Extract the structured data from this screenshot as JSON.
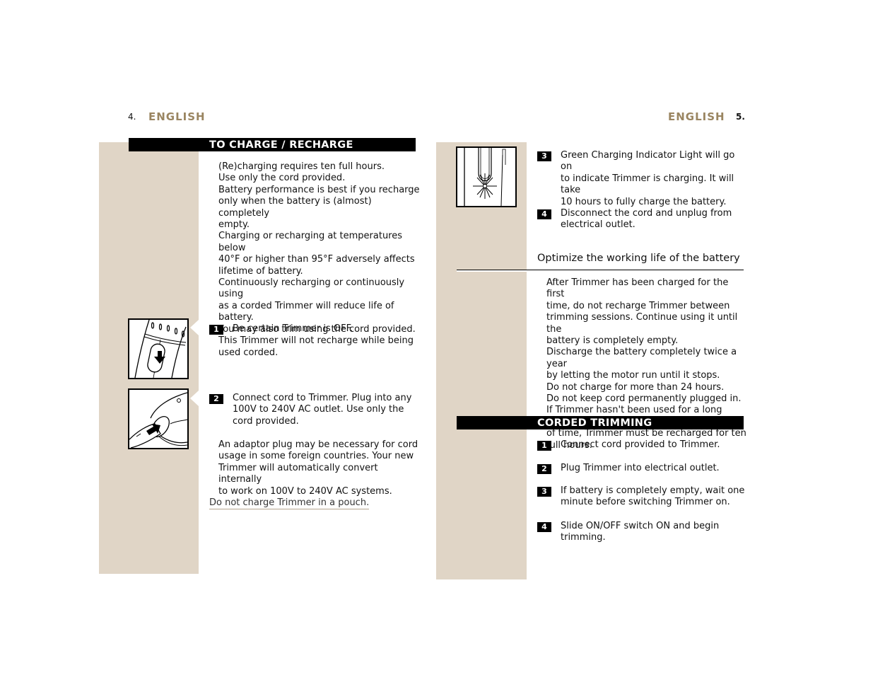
{
  "left_page": {
    "page_number": "4.",
    "language": "ENGLISH",
    "section_title": "TO CHARGE / RECHARGE",
    "intro_lines": [
      "(Re)charging requires ten full hours.",
      "Use only the cord provided.",
      "Battery performance is best if you recharge",
      "only when the battery is (almost) completely",
      "empty.",
      "Charging or recharging at temperatures below",
      "40°F or higher than 95°F adversely affects",
      "lifetime of battery.",
      "Continuously recharging or continuously using",
      "as a corded Trimmer will reduce life of battery.",
      "You may also trim using the cord provided.",
      "This Trimmer will not recharge while being",
      "used corded."
    ],
    "steps": [
      {
        "number": "1",
        "lines": [
          "Be certain Trimmer is OFF."
        ]
      },
      {
        "number": "2",
        "lines": [
          "Connect cord to Trimmer.  Plug into any",
          "100V to 240V AC outlet.  Use only the",
          "cord provided."
        ]
      }
    ],
    "adaptor_note_lines": [
      "An adaptor plug may be necessary for cord",
      "usage in some foreign countries. Your new",
      "Trimmer will automatically convert internally",
      "to work on 100V to 240V AC systems."
    ],
    "warning": "Do not charge Trimmer in a pouch.",
    "figures": [
      "switch-off-illustration",
      "plug-cord-illustration"
    ]
  },
  "right_page": {
    "page_number": "5.",
    "language": "ENGLISH",
    "steps": [
      {
        "number": "3",
        "lines": [
          "Green Charging Indicator Light will go on",
          "to indicate Trimmer is charging. It will take",
          "10 hours to fully charge the battery."
        ]
      },
      {
        "number": "4",
        "lines": [
          "Disconnect the cord and unplug from",
          "electrical outlet."
        ]
      }
    ],
    "subheading": "Optimize the working life of the battery",
    "battery_tips_lines": [
      "After Trimmer has been charged for the first",
      "time, do not recharge Trimmer between",
      "trimming sessions.  Continue using it until the",
      "battery is completely empty.",
      "Discharge the battery completely twice a year",
      "by letting the motor run until it stops.",
      "Do not charge for more than 24 hours.",
      "Do not keep cord permanently plugged in.",
      "If Trimmer hasn't been used for a long period",
      "of time, Trimmer must be recharged for ten",
      "full hours."
    ],
    "section_title": "CORDED TRIMMING",
    "corded_steps": [
      {
        "number": "1",
        "lines": [
          "Connect cord provided to Trimmer."
        ]
      },
      {
        "number": "2",
        "lines": [
          "Plug Trimmer into electrical outlet."
        ]
      },
      {
        "number": "3",
        "lines": [
          "If battery is completely empty, wait one",
          "minute before switching Trimmer on."
        ]
      },
      {
        "number": "4",
        "lines": [
          "Slide ON/OFF switch ON and begin",
          "trimming."
        ]
      }
    ],
    "figures": [
      "charging-light-illustration"
    ]
  },
  "colors": {
    "accent": "#9a8561",
    "panel": "#e0d5c6",
    "bar": "#000000"
  }
}
